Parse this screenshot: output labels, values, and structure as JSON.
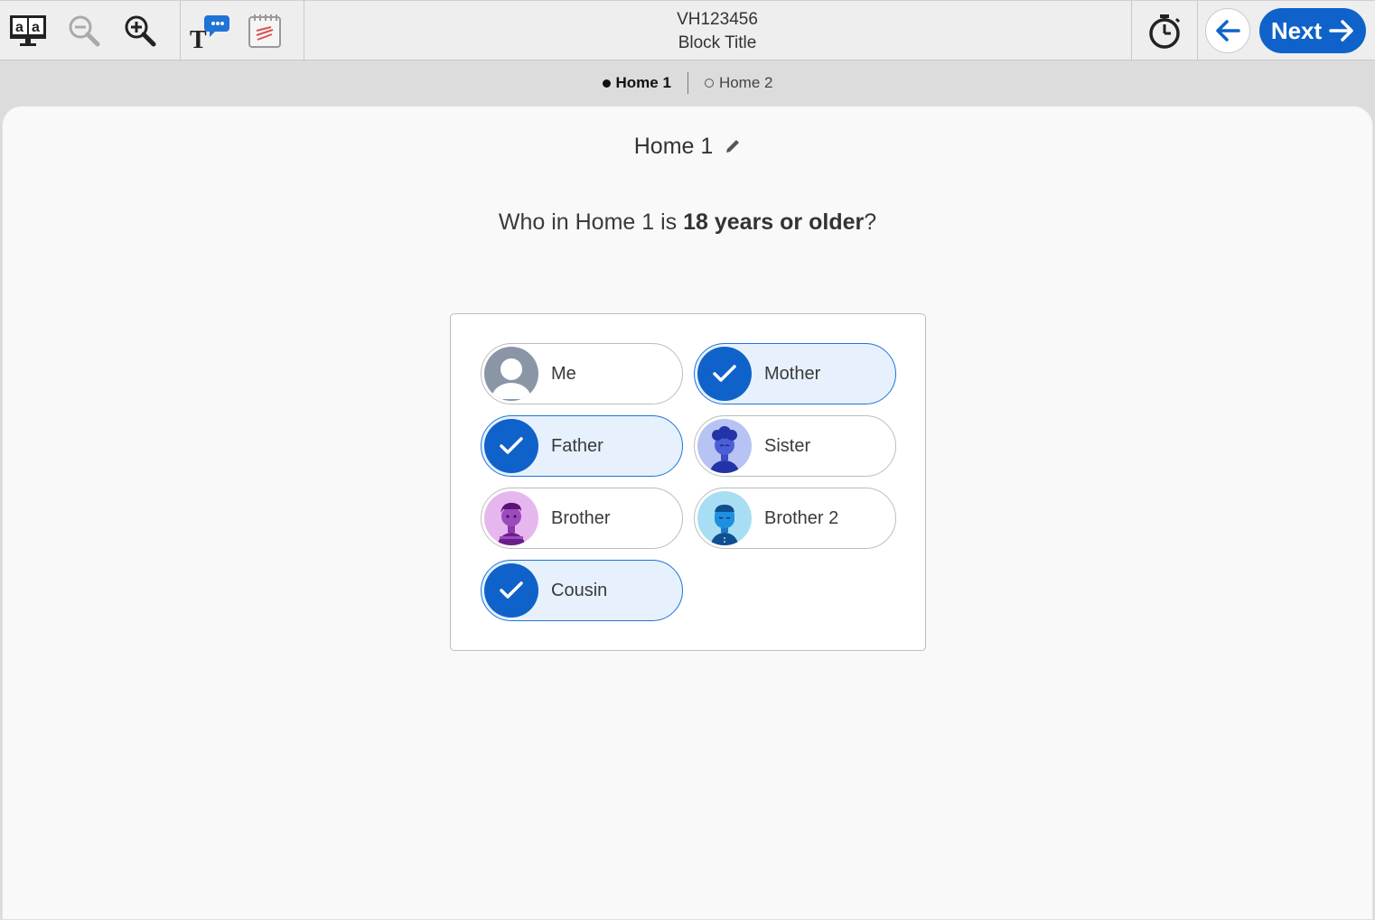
{
  "header": {
    "id": "VH123456",
    "block_title": "Block Title",
    "next_label": "Next"
  },
  "toolbar": {
    "icons": [
      "translate-screen-icon",
      "zoom-out-icon",
      "zoom-in-icon",
      "text-to-speech-icon",
      "scratchwork-icon",
      "timer-icon",
      "back-arrow-icon",
      "next-arrow-icon"
    ]
  },
  "tabs": [
    {
      "label": "Home 1",
      "active": true
    },
    {
      "label": "Home 2",
      "active": false
    }
  ],
  "main": {
    "title": "Home 1",
    "question_prefix": "Who in Home 1 is ",
    "question_bold": "18 years or older",
    "question_suffix": "?"
  },
  "options": [
    {
      "label": "Me",
      "selected": false,
      "avatar": "generic-user"
    },
    {
      "label": "Mother",
      "selected": true,
      "avatar": "check"
    },
    {
      "label": "Father",
      "selected": true,
      "avatar": "check"
    },
    {
      "label": "Sister",
      "selected": false,
      "avatar": "sister"
    },
    {
      "label": "Brother",
      "selected": false,
      "avatar": "brother"
    },
    {
      "label": "Brother 2",
      "selected": false,
      "avatar": "brother2"
    },
    {
      "label": "Cousin",
      "selected": true,
      "avatar": "check"
    }
  ],
  "colors": {
    "accent": "#0f62c9",
    "selected_bg": "#e6f1fd"
  }
}
